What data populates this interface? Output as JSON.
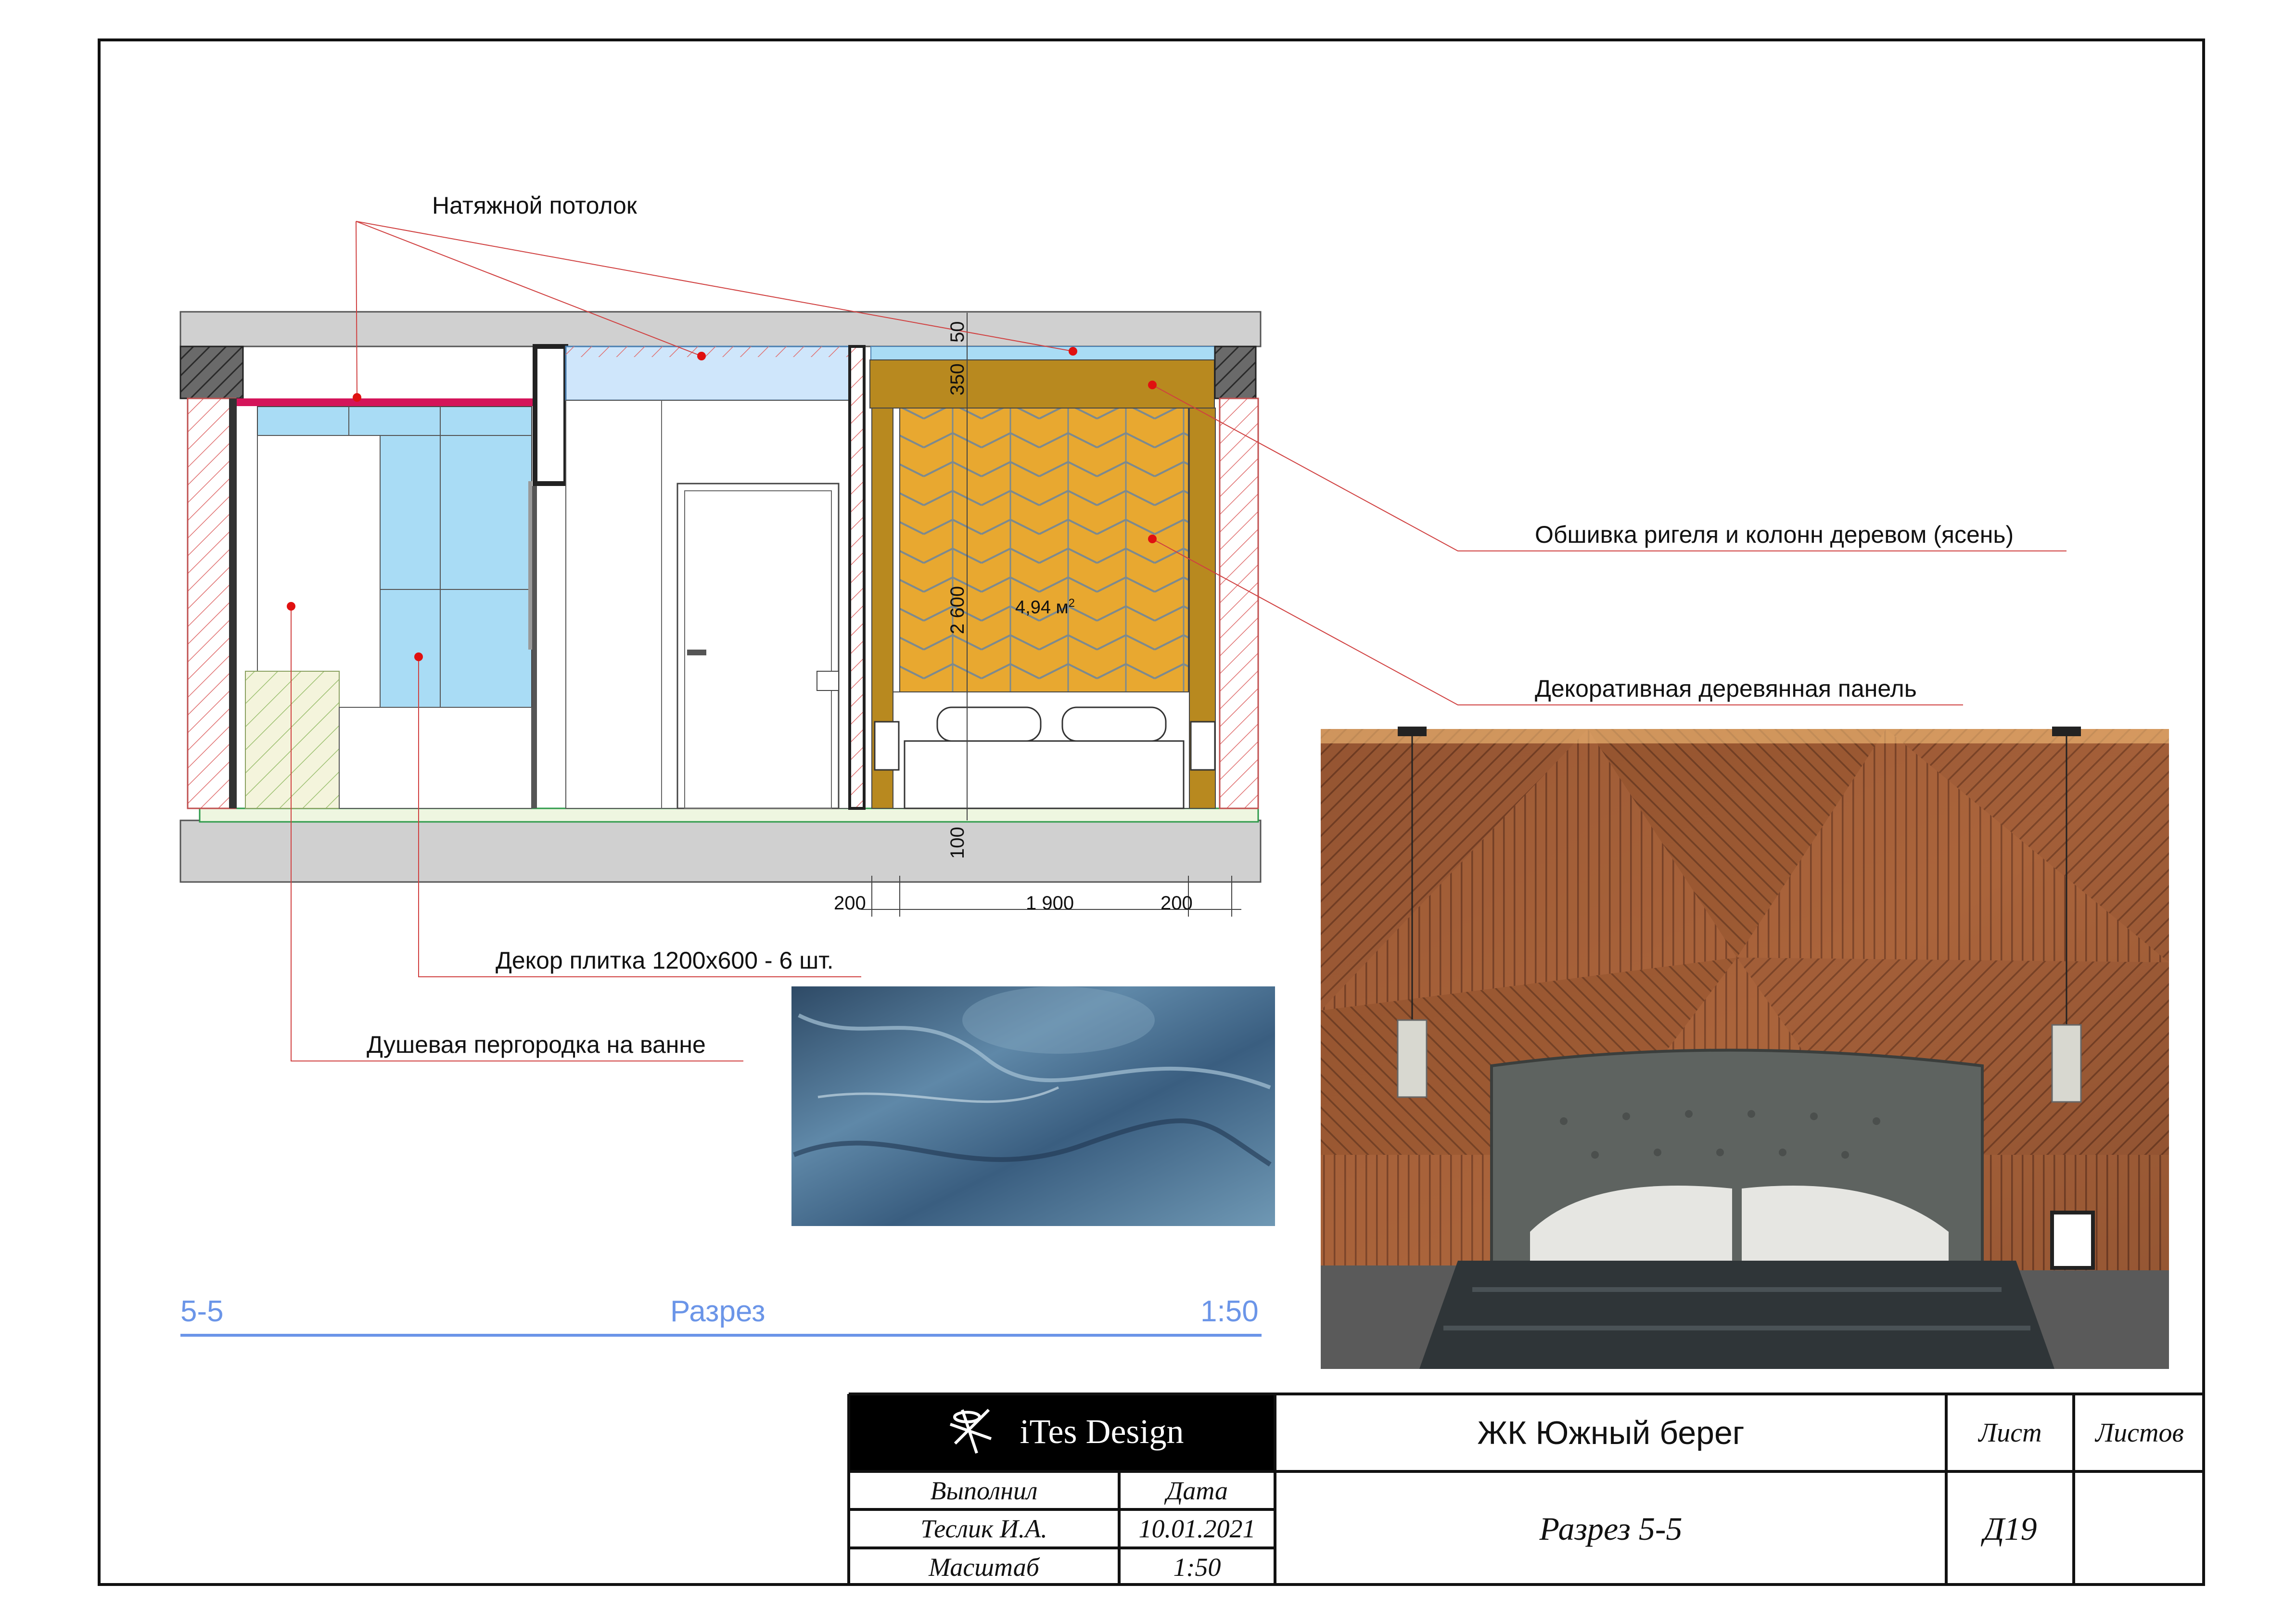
{
  "drawing": {
    "section_id": "5-5",
    "section_title": "Разрез",
    "section_scale": "1:50",
    "area_label": "4,94 м",
    "area_sup": "2",
    "dims": {
      "ceiling_gap": "50",
      "beam": "350",
      "height": "2 600",
      "floor": "100",
      "left_side": "200",
      "bed_width": "1 900",
      "right_side": "200"
    }
  },
  "callouts": {
    "stretch_ceiling": "Натяжной потолок",
    "wood_cladding": "Обшивка ригеля и колонн деревом (ясень)",
    "wood_panel": "Декоративная деревянная панель",
    "decor_tile": "Декор плитка 1200x600 - 6 шт.",
    "shower_screen": "Душевая пергородка на ванне"
  },
  "title_block": {
    "logo_text": "iTes Design",
    "project": "ЖК Южный берег",
    "sheet_label": "Лист",
    "sheets_label": "Листов",
    "performed_label": "Выполнил",
    "date_label": "Дата",
    "author": "Теслик И.А.",
    "date": "10.01.2021",
    "scale_label": "Масштаб",
    "scale": "1:50",
    "sheet_title": "Разрез 5-5",
    "sheet_number": "Д19",
    "sheets_total": ""
  },
  "colors": {
    "wood": "#c68a2a",
    "tile_blue": "#a9dcf5",
    "hatch": "#e07070",
    "accent_line": "#6b95e8",
    "leader": "#d04040"
  },
  "icons": [
    "dragonfly-icon"
  ]
}
